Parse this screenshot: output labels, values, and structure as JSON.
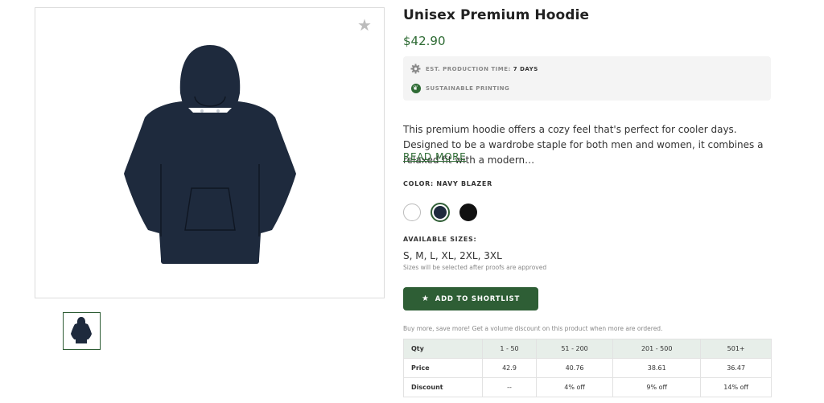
{
  "gallery": {
    "favorite_icon": "star-icon",
    "main_image_alt": "Navy hoodie",
    "thumbnail_alt": "Navy hoodie thumbnail",
    "hoodie_color": "#1e2a3d"
  },
  "product": {
    "title": "Unisex Premium Hoodie",
    "price": "$42.90"
  },
  "info": {
    "production_label": "EST. PRODUCTION TIME:",
    "production_value": "7 DAYS",
    "production_icon": "gear-icon",
    "sustainable_label": "SUSTAINABLE PRINTING",
    "sustainable_icon": "leaf-icon"
  },
  "description": {
    "text": "This premium hoodie offers a cozy feel that's perfect for cooler days. Designed to be a wardrobe staple for both men and women, it combines a relaxed fit with a modern…",
    "read_more": "READ MORE"
  },
  "color": {
    "label": "COLOR: NAVY BLAZER",
    "swatches": [
      {
        "name": "White",
        "hex": "#ffffff"
      },
      {
        "name": "Navy Blazer",
        "hex": "#1e2a3d",
        "selected": true
      },
      {
        "name": "Black",
        "hex": "#111111"
      }
    ]
  },
  "sizes": {
    "label": "AVAILABLE SIZES:",
    "value": "S, M, L, XL, 2XL, 3XL",
    "note": "Sizes will be selected after proofs are approved"
  },
  "shortlist": {
    "label": "ADD TO SHORTLIST",
    "icon": "star-icon"
  },
  "volume": {
    "note": "Buy more, save more! Get a volume discount on this product when more are ordered.",
    "header": [
      "Qty",
      "1 - 50",
      "51 - 200",
      "201 - 500",
      "501+"
    ],
    "price_row": [
      "Price",
      "42.9",
      "40.76",
      "38.61",
      "36.47"
    ],
    "discount_row": [
      "Discount",
      "--",
      "4% off",
      "9% off",
      "14% off"
    ]
  },
  "colors": {
    "accent": "#2e6b34",
    "button": "#2e5e35",
    "table_header": "#e7eee9"
  }
}
